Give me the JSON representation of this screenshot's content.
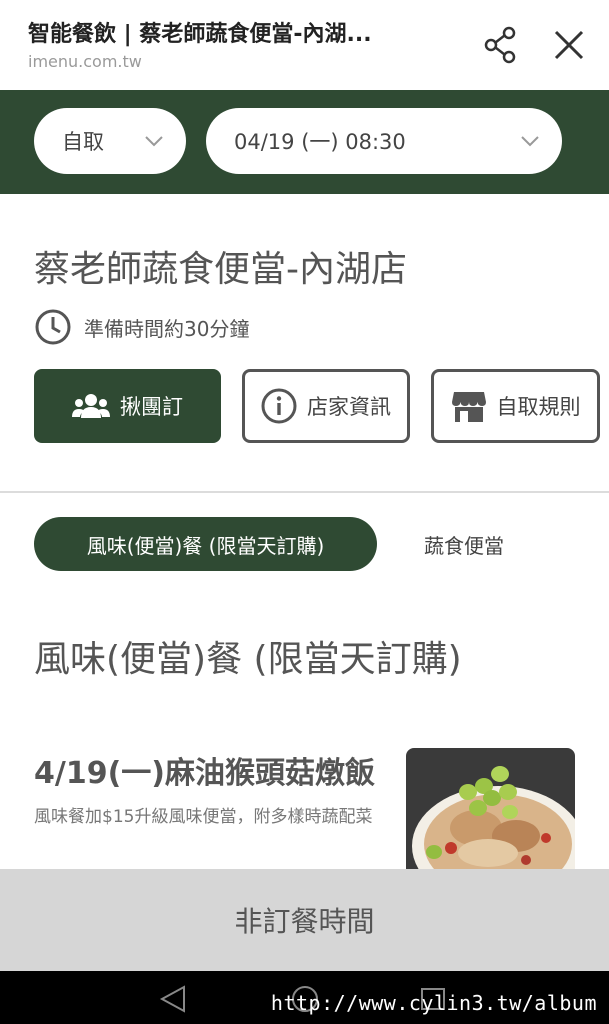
{
  "header": {
    "title": "智能餐飲 | 蔡老師蔬食便當-內湖...",
    "url": "imenu.com.tw"
  },
  "selectors": {
    "mode": "自取",
    "datetime": "04/19 (一) 08:30"
  },
  "store": {
    "name": "蔡老師蔬食便當-內湖店",
    "prep_time": "準備時間約30分鐘"
  },
  "actions": {
    "group_order": "揪團訂",
    "store_info": "店家資訊",
    "pickup_rules": "自取規則"
  },
  "categories": [
    {
      "label": "風味(便當)餐 (限當天訂購)",
      "active": true
    },
    {
      "label": "蔬食便當",
      "active": false
    }
  ],
  "section_title": "風味(便當)餐 (限當天訂購)",
  "menu_item": {
    "name": "4/19(一)麻油猴頭菇燉飯",
    "description": "風味餐加$15升級風味便當，附多樣時蔬配菜"
  },
  "status_bar": "非訂餐時間",
  "watermark": "http://www.cylin3.tw/album",
  "colors": {
    "brand_green": "#2f4a33",
    "status_gray": "#d6d6d6"
  },
  "icons": [
    "share-icon",
    "close-icon",
    "chevron-down-icon",
    "clock-icon",
    "group-icon",
    "info-icon",
    "store-icon"
  ]
}
